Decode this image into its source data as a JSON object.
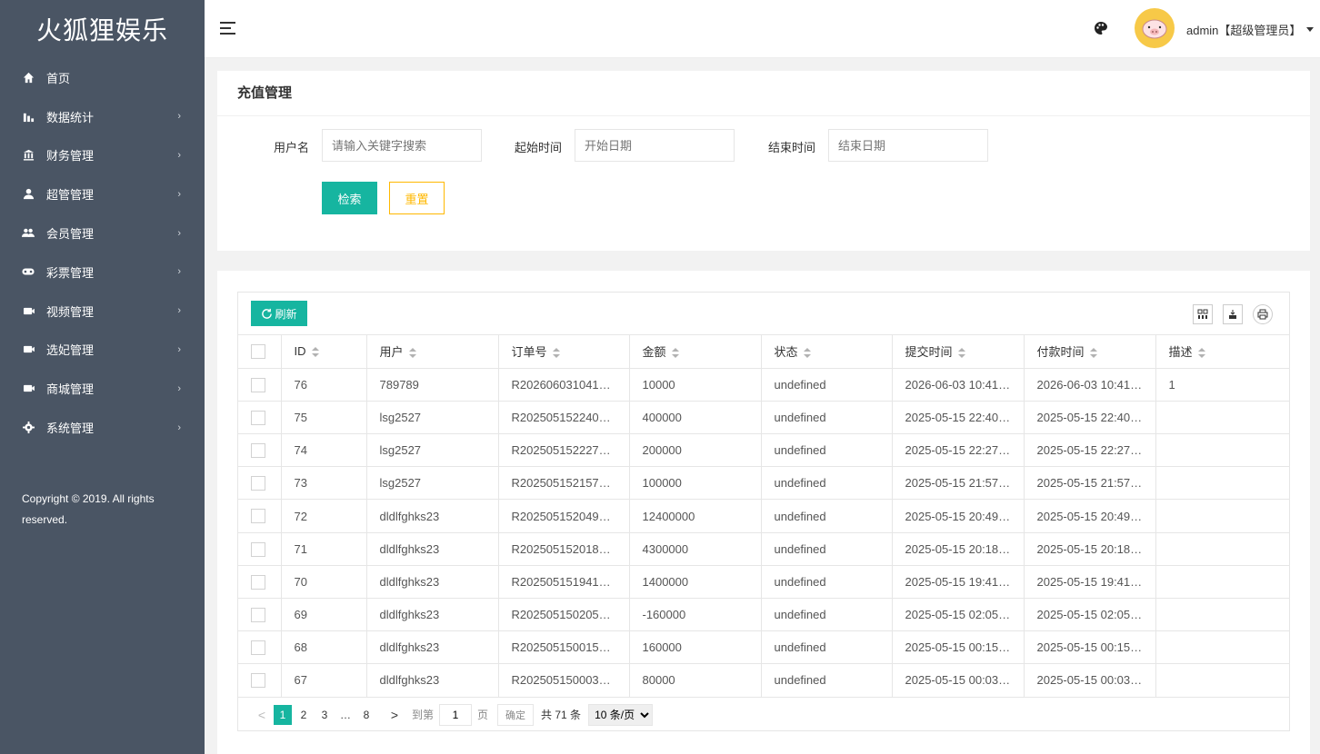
{
  "brand": "火狐狸娱乐",
  "sidebar": {
    "items": [
      {
        "label": "首页",
        "icon": "home-icon",
        "has_children": false
      },
      {
        "label": "数据统计",
        "icon": "bar-chart-icon",
        "has_children": true
      },
      {
        "label": "财务管理",
        "icon": "bank-icon",
        "has_children": true
      },
      {
        "label": "超管管理",
        "icon": "user-icon",
        "has_children": true
      },
      {
        "label": "会员管理",
        "icon": "users-icon",
        "has_children": true
      },
      {
        "label": "彩票管理",
        "icon": "gamepad-icon",
        "has_children": true
      },
      {
        "label": "视频管理",
        "icon": "video-icon",
        "has_children": true
      },
      {
        "label": "选妃管理",
        "icon": "video-icon",
        "has_children": true
      },
      {
        "label": "商城管理",
        "icon": "video-icon",
        "has_children": true
      },
      {
        "label": "系统管理",
        "icon": "gear-icon",
        "has_children": true
      }
    ],
    "copyright": "Copyright © 2019. All rights reserved."
  },
  "header": {
    "user_label": "admin【超级管理员】"
  },
  "search": {
    "title": "充值管理",
    "username_label": "用户名",
    "username_placeholder": "请输入关键字搜索",
    "start_label": "起始时间",
    "start_placeholder": "开始日期",
    "end_label": "结束时间",
    "end_placeholder": "结束日期",
    "search_button": "检索",
    "reset_button": "重置"
  },
  "table": {
    "refresh_label": "刷新",
    "columns": [
      "ID",
      "用户",
      "订单号",
      "金额",
      "状态",
      "提交时间",
      "付款时间",
      "描述"
    ],
    "rows": [
      [
        "76",
        "789789",
        "R202606031041…",
        "10000",
        "undefined",
        "2026-06-03 10:41…",
        "2026-06-03 10:41…",
        "1"
      ],
      [
        "75",
        "lsg2527",
        "R202505152240…",
        "400000",
        "undefined",
        "2025-05-15 22:40…",
        "2025-05-15 22:40…",
        ""
      ],
      [
        "74",
        "lsg2527",
        "R202505152227…",
        "200000",
        "undefined",
        "2025-05-15 22:27…",
        "2025-05-15 22:27…",
        ""
      ],
      [
        "73",
        "lsg2527",
        "R202505152157…",
        "100000",
        "undefined",
        "2025-05-15 21:57…",
        "2025-05-15 21:57…",
        ""
      ],
      [
        "72",
        "dldlfghks23",
        "R202505152049…",
        "12400000",
        "undefined",
        "2025-05-15 20:49…",
        "2025-05-15 20:49…",
        ""
      ],
      [
        "71",
        "dldlfghks23",
        "R202505152018…",
        "4300000",
        "undefined",
        "2025-05-15 20:18…",
        "2025-05-15 20:18…",
        ""
      ],
      [
        "70",
        "dldlfghks23",
        "R202505151941…",
        "1400000",
        "undefined",
        "2025-05-15 19:41…",
        "2025-05-15 19:41…",
        ""
      ],
      [
        "69",
        "dldlfghks23",
        "R202505150205…",
        "-160000",
        "undefined",
        "2025-05-15 02:05…",
        "2025-05-15 02:05…",
        ""
      ],
      [
        "68",
        "dldlfghks23",
        "R202505150015…",
        "160000",
        "undefined",
        "2025-05-15 00:15…",
        "2025-05-15 00:15…",
        ""
      ],
      [
        "67",
        "dldlfghks23",
        "R202505150003…",
        "80000",
        "undefined",
        "2025-05-15 00:03…",
        "2025-05-15 00:03…",
        ""
      ]
    ]
  },
  "pager": {
    "prev": "<",
    "pages": [
      "1",
      "2",
      "3"
    ],
    "ellipsis": "…",
    "last_page": "8",
    "next": ">",
    "goto_label": "到第",
    "goto_value": "1",
    "page_suffix": "页",
    "confirm": "确定",
    "total": "共 71 条",
    "per_page": "10 条/页"
  },
  "colors": {
    "sidebar_bg": "#4a5564",
    "accent": "#16b5a0",
    "warning": "#ffb800"
  }
}
